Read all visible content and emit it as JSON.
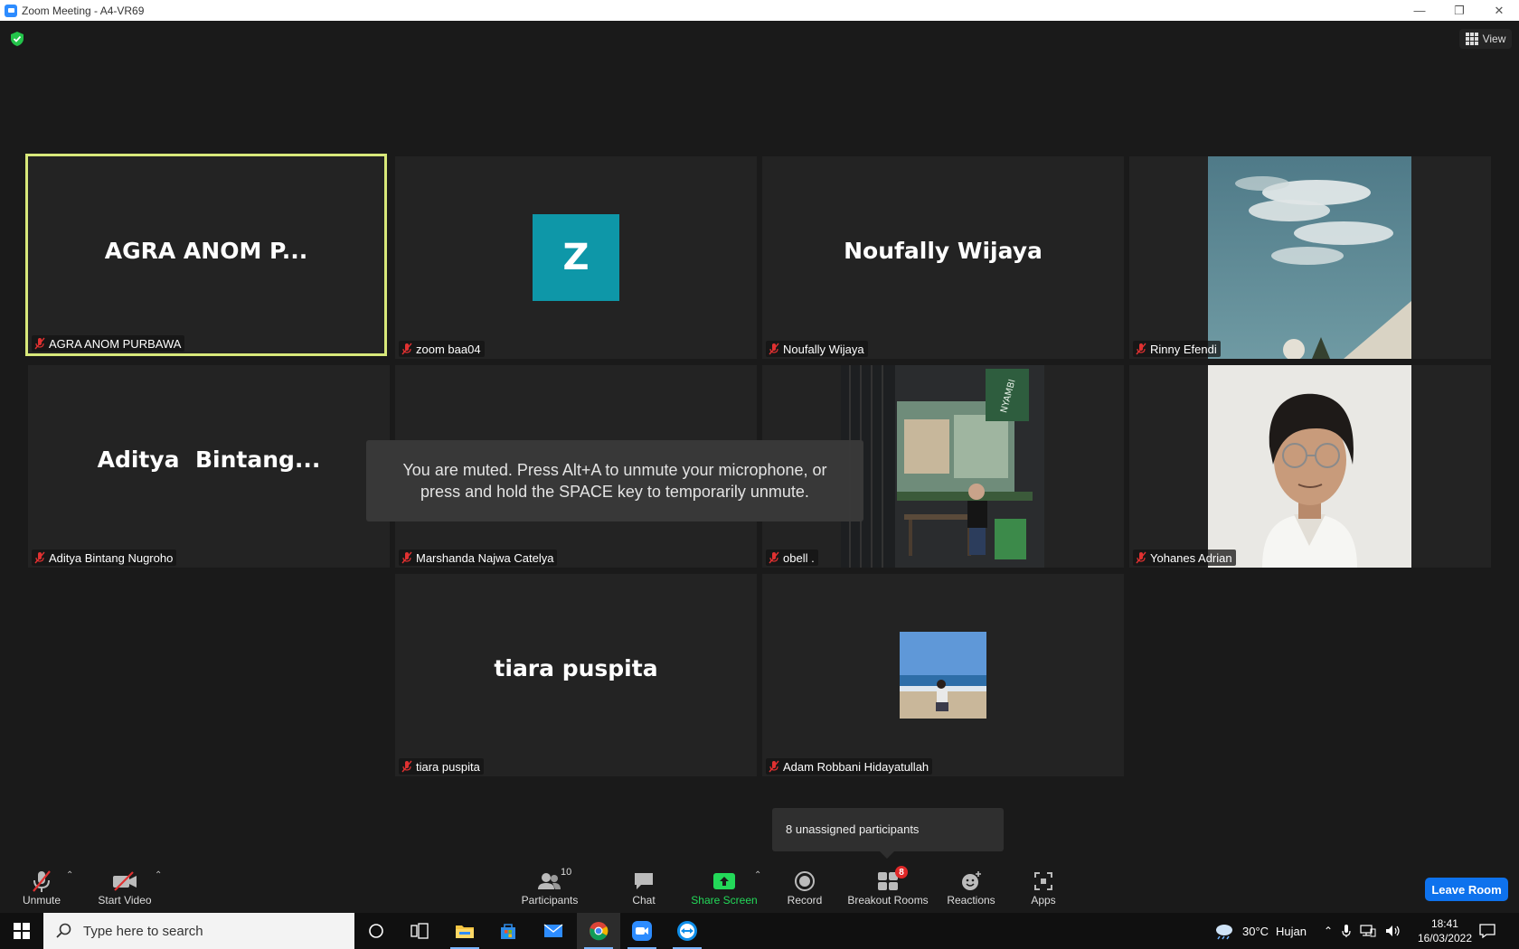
{
  "window": {
    "title": "Zoom Meeting - A4-VR69"
  },
  "view_button": {
    "label": "View"
  },
  "tiles": [
    {
      "display": "AGRA ANOM P...",
      "label": "AGRA ANOM PURBAWA",
      "kind": "name",
      "active": true
    },
    {
      "display": "Z",
      "label": "zoom baa04",
      "kind": "avatar",
      "avatar_color": "#0e97a8"
    },
    {
      "display": "Noufally Wijaya",
      "label": "Noufally Wijaya",
      "kind": "name"
    },
    {
      "display": "",
      "label": "Rinny Efendi",
      "kind": "photo-sky"
    },
    {
      "display": "Aditya  Bintang...",
      "label": "Aditya Bintang Nugroho",
      "kind": "name"
    },
    {
      "display": "",
      "label": "Marshanda Najwa Catelya",
      "kind": "name"
    },
    {
      "display": "",
      "label": "obell .",
      "kind": "photo-cafe",
      "sign": "NYAMBI"
    },
    {
      "display": "",
      "label": "Yohanes Adrian",
      "kind": "photo-person"
    },
    {
      "display": "tiara puspita",
      "label": "tiara puspita",
      "kind": "name"
    },
    {
      "display": "",
      "label": "Adam Robbani Hidayatullah",
      "kind": "photo-beach"
    }
  ],
  "muted_toast": {
    "text": "You are muted. Press Alt+A to unmute your microphone, or press and hold the SPACE key to temporarily unmute."
  },
  "breakout_tooltip": {
    "text": "8 unassigned participants"
  },
  "toolbar": {
    "unmute": "Unmute",
    "start_video": "Start Video",
    "participants": "Participants",
    "participants_count": "10",
    "chat": "Chat",
    "share_screen": "Share Screen",
    "record": "Record",
    "breakout_rooms": "Breakout Rooms",
    "breakout_badge": "8",
    "reactions": "Reactions",
    "apps": "Apps",
    "leave": "Leave Room"
  },
  "taskbar": {
    "search_placeholder": "Type here to search",
    "weather_temp": "30°C",
    "weather_desc": "Hujan",
    "time": "18:41",
    "date": "16/03/2022"
  },
  "colors": {
    "active_speaker_border": "#d8e87a",
    "share_green": "#23d959",
    "leave_blue": "#0e72ed",
    "badge_red": "#e02828"
  }
}
